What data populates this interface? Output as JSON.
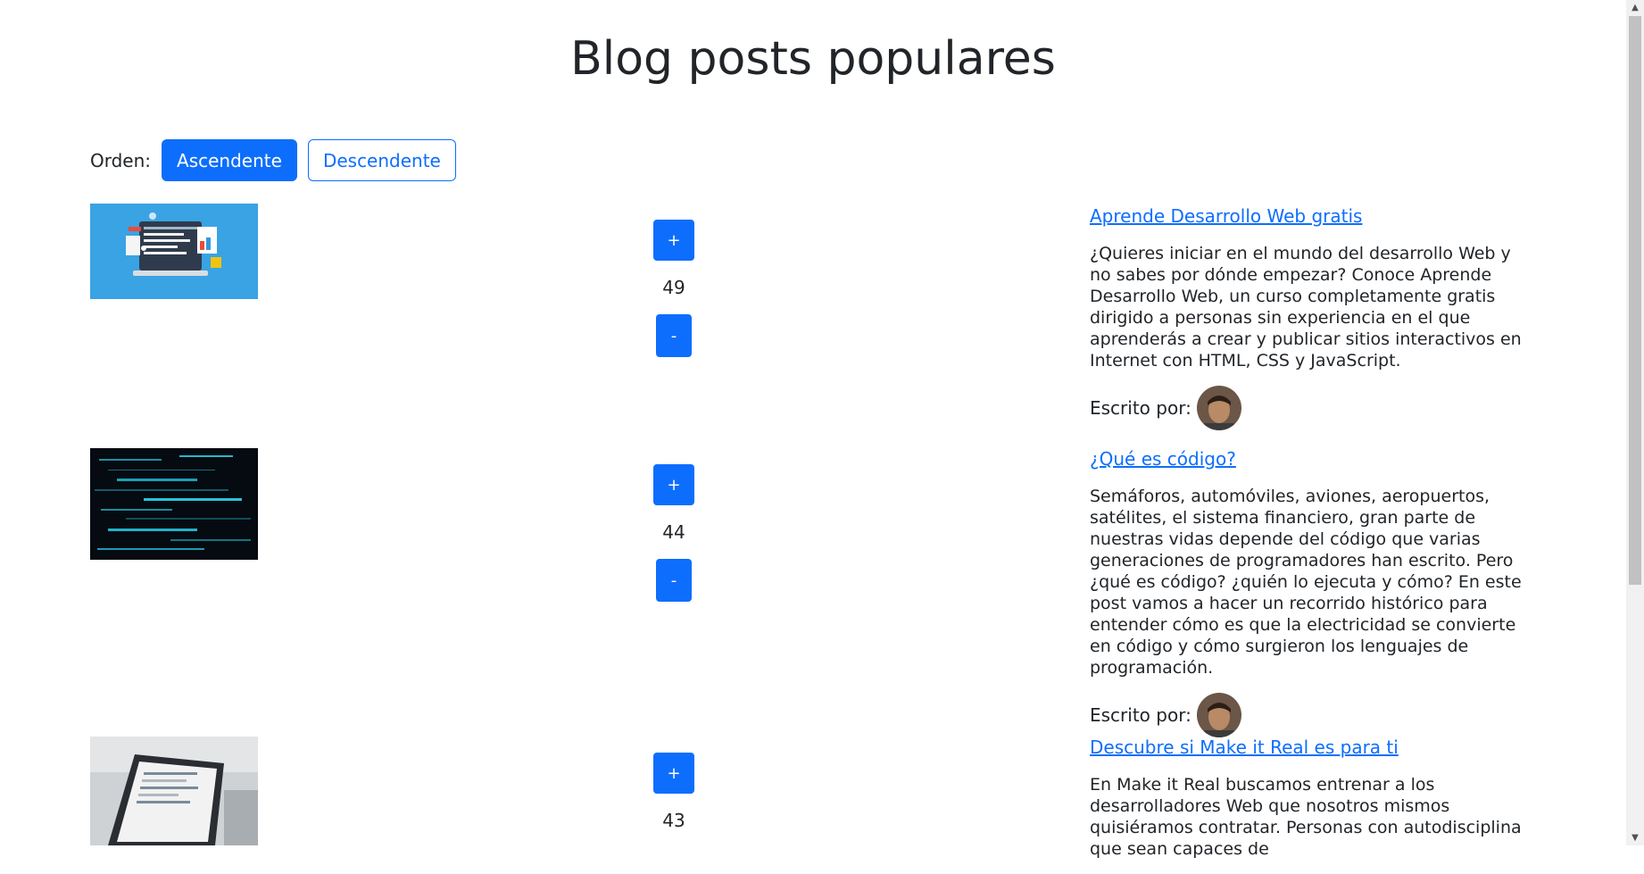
{
  "page_title": "Blog posts populares",
  "order": {
    "label": "Orden:",
    "asc_label": "Ascendente",
    "desc_label": "Descendente"
  },
  "vote_buttons": {
    "plus": "+",
    "minus": "-"
  },
  "author_label": "Escrito por:",
  "posts": [
    {
      "title": "Aprende Desarrollo Web gratis",
      "description": "¿Quieres iniciar en el mundo del desarrollo Web y no sabes por dónde empezar? Conoce Aprende Desarrollo Web, un curso completamente gratis dirigido a personas sin experiencia en el que aprenderás a crear y publicar sitios interactivos en Internet con HTML, CSS y JavaScript.",
      "votes": "49"
    },
    {
      "title": "¿Qué es código?",
      "description": "Semáforos, automóviles, aviones, aeropuertos, satélites, el sistema financiero, gran parte de nuestras vidas depende del código que varias generaciones de programadores han escrito. Pero ¿qué es código? ¿quién lo ejecuta y cómo? En este post vamos a hacer un recorrido histórico para entender cómo es que la electricidad se convierte en código y cómo surgieron los lenguajes de programación.",
      "votes": "44"
    },
    {
      "title": "Descubre si Make it Real es para ti",
      "description": "En Make it Real buscamos entrenar a los desarrolladores Web que nosotros mismos quisiéramos contratar. Personas con autodisciplina que sean capaces de",
      "votes": "43"
    }
  ]
}
